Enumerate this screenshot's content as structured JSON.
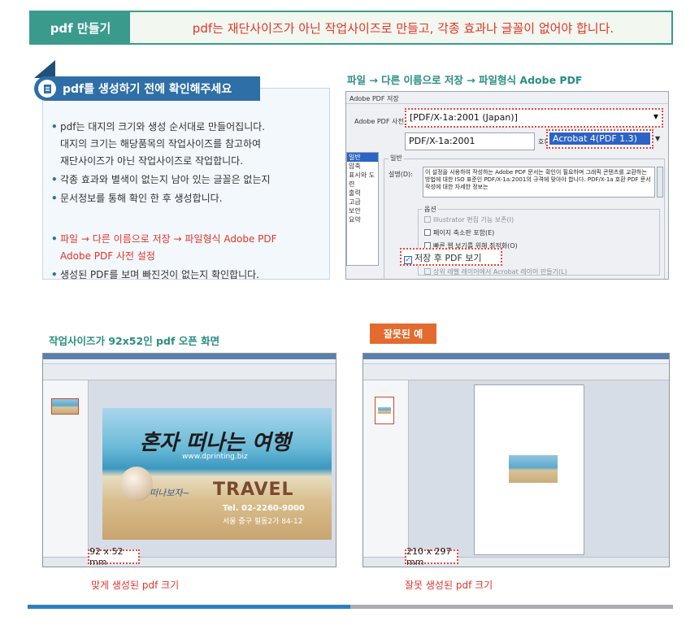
{
  "header": {
    "tag": "pdf 만들기",
    "text": "pdf는 재단사이즈가 아닌 작업사이즈로 만들고, 각종 효과나 글꼴이 없어야 합니다."
  },
  "check": {
    "title": "pdf를 생성하기 전에 확인해주세요",
    "items": [
      "pdf는 대지의 크기와 생성 순서대로 만들어집니다.",
      "대지의 크기는 해당품목의 작업사이즈를 참고하여",
      "재단사이즈가 아닌 작업사이즈로 작업합니다.",
      "각종 효과와 별색이 없는지 남아 있는 글꼴은 없는지",
      "문서정보를 통해 확인 한 후 생성합니다.",
      "파일 → 다른 이름으로 저장 → 파일형식 Adobe PDF",
      "Adobe PDF 사전 설정",
      "생성된 PDF를 보며 빠진것이 없는지 확인합니다."
    ]
  },
  "save_section": {
    "title": "파일 → 다른 이름으로 저장 → 파일형식 Adobe PDF"
  },
  "dialog": {
    "window_title": "Adobe PDF 저장",
    "preset_label": "Adobe PDF 사전",
    "preset_value": "[PDF/X-1a:2001 (Japan)]",
    "standard_value": "PDF/X-1a:2001",
    "compat_label": "호환:",
    "compat_value": "Acrobat 4(PDF 1.3)",
    "side_items": [
      "일반",
      "압축",
      "표시와 도련",
      "출력",
      "고급",
      "보안",
      "요약"
    ],
    "group_label": "일반",
    "desc_label": "설명(D):",
    "desc_text": "이 설정을 사용하여 작성하는 Adobe PDF 문서는 확인이 필요하며 그래픽 콘텐츠를 교환하는 방법에 대한 ISO 표준인 PDF/X-1a:2001의 규격에 맞아야 합니다. PDF/X-1a 호환 PDF 문서 작성에 대한 자세한 정보는",
    "options_label": "옵션",
    "opt1": "Illustrator 편집 기능 보존(I)",
    "opt2": "페이지 축소판 포함(E)",
    "opt3": "빠른 웹 보기를 위해 최적화(O)",
    "opt4": "저장 후 PDF 보기",
    "opt5": "상위 레벨 레이어에서 Acrobat 레이어 만들기(L)"
  },
  "correct": {
    "title": "작업사이즈가 92x52인 pdf 오픈 화면",
    "size": "92 x 52 mm",
    "caption": "맞게 생성된 pdf 크기"
  },
  "wrong": {
    "badge": "잘못된 예",
    "size": "210 x 297 mm",
    "caption": "잘못 생성된 pdf 크기"
  },
  "postcard": {
    "title": "혼자 떠나는 여행",
    "url": "www.dprinting.biz",
    "script": "떠나보자~",
    "travel": "TRAVEL",
    "tel": "Tel. 02-2260-9000",
    "addr": "서울 중구 필동2가 84-12"
  },
  "colors": {
    "teal": "#3a9b8d",
    "red": "#e2352a",
    "blue": "#2f6fa7"
  }
}
